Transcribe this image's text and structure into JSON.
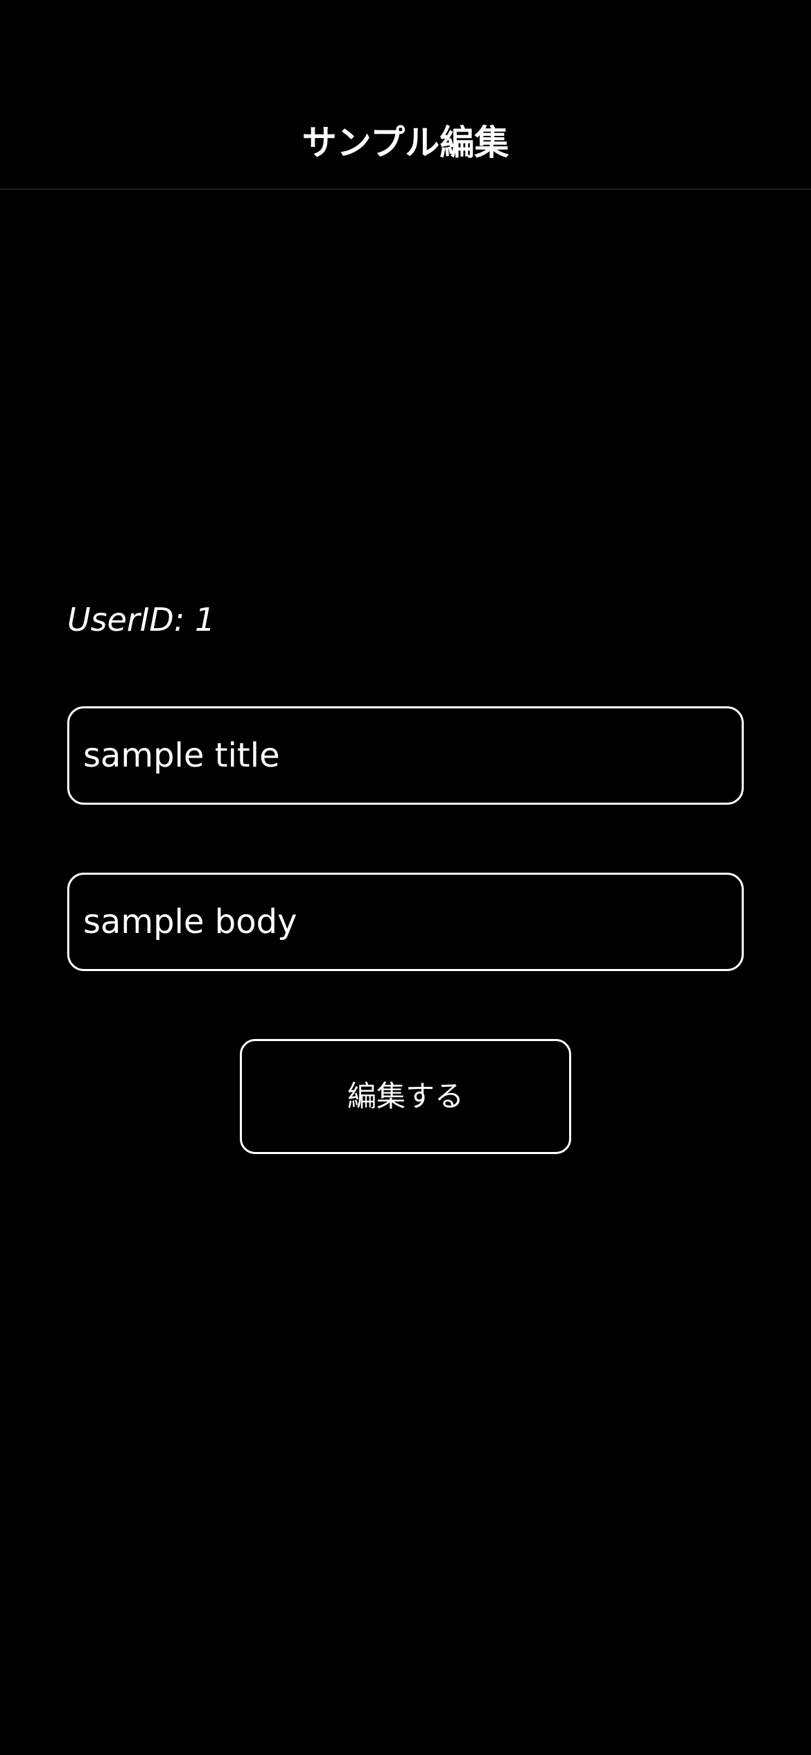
{
  "nav": {
    "title": "サンプル編集"
  },
  "form": {
    "user_id_label": "UserID: 1",
    "title_value": "sample title",
    "body_value": "sample body",
    "submit_label": "編集する"
  },
  "colors": {
    "background": "#000000",
    "foreground": "#ffffff"
  }
}
